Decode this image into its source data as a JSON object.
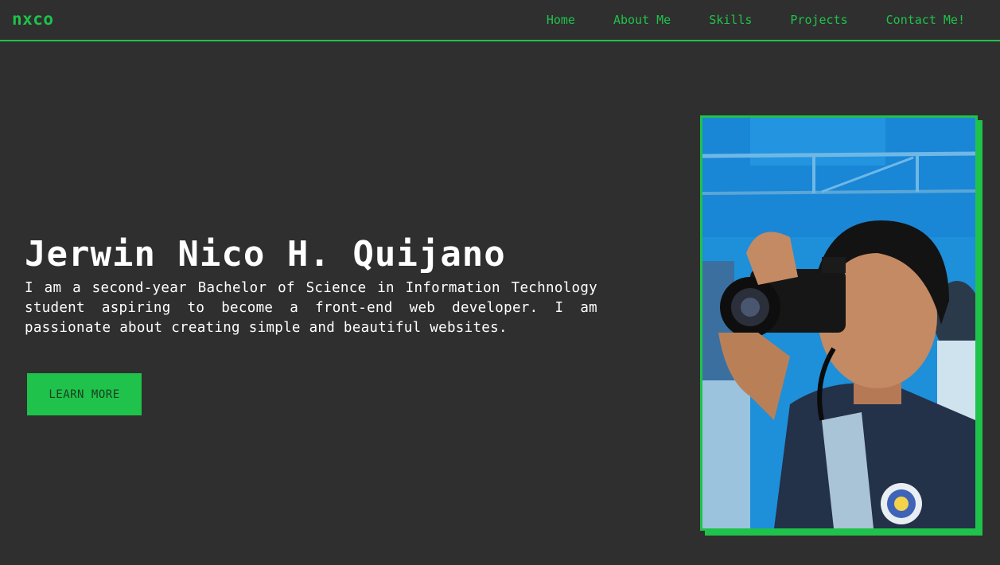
{
  "navbar": {
    "logo": "nxco",
    "links": [
      {
        "label": "Home"
      },
      {
        "label": "About Me"
      },
      {
        "label": "Skills"
      },
      {
        "label": "Projects"
      },
      {
        "label": "Contact Me!"
      }
    ]
  },
  "hero": {
    "name": "Jerwin Nico H. Quijano",
    "description": "I am a second-year Bachelor of Science in Information Technology student aspiring to become a front-end web developer. I am passionate about creating simple and beautiful websites.",
    "cta_label": "LEARN MORE"
  },
  "photo": {
    "subject": "person-with-camera-photo"
  },
  "colors": {
    "accent": "#1fc24a",
    "background": "#2f2f2f",
    "text": "#ffffff"
  }
}
